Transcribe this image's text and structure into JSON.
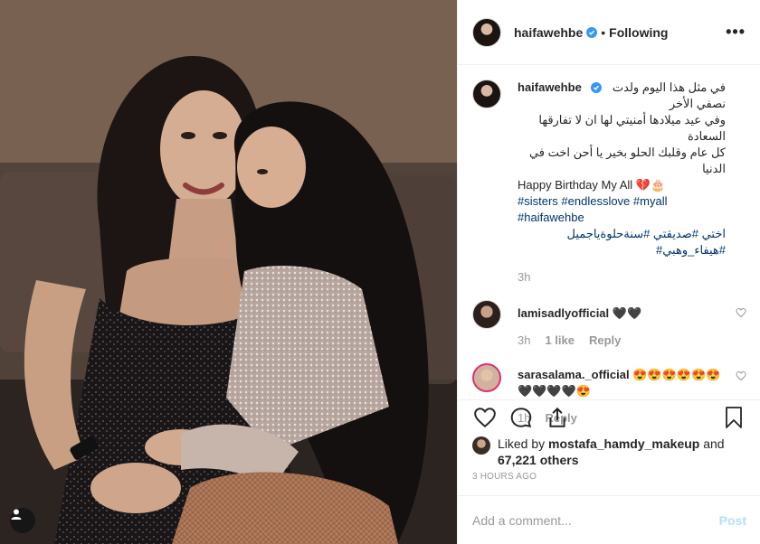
{
  "post": {
    "username": "haifawehbe",
    "follow_status": "Following",
    "more_label": "•••",
    "caption": {
      "line1": "في مثل هذا اليوم ولدت نصفي الأخر",
      "line2": "وفي عيد ميلادها أمنيتي لها ان لا تفارقها السعادة",
      "line3": "كل عام وقلبك الحلو بخير يا أحن اخت في الدنيا",
      "line4": "Happy Birthday My All 💔🎂",
      "hashtags1": "#sisters #endlesslove #myall",
      "hashtags2": "#haifawehbe",
      "hashtags3": "اختي  #صديقتي  #سنةحلوةياجميل  #هيفاء_وهبي#",
      "time": "3h"
    },
    "comments": [
      {
        "username": "lamisadlyofficial",
        "text": "🖤🖤",
        "time": "3h",
        "likes": "1 like",
        "reply": "Reply"
      },
      {
        "username": "sarasalama._official",
        "text": "😍😍😍😍😍😍 🖤🖤🖤🖤😍",
        "time": "1h",
        "reply": "Reply"
      }
    ],
    "liked_by_prefix": "Liked by",
    "liked_by_user": "mostafa_hamdy_makeup",
    "liked_by_and": "and",
    "liked_by_others": "67,221 others",
    "timestamp": "3 HOURS AGO",
    "add_comment_placeholder": "Add a comment...",
    "post_button": "Post"
  },
  "colors": {
    "verified": "#3897f0",
    "hashtag": "#003569",
    "muted": "#999999",
    "post_disabled": "#b2dffc"
  },
  "icons": [
    "verified-icon",
    "heart-icon",
    "comment-icon",
    "share-icon",
    "bookmark-icon",
    "user-tag-icon"
  ]
}
